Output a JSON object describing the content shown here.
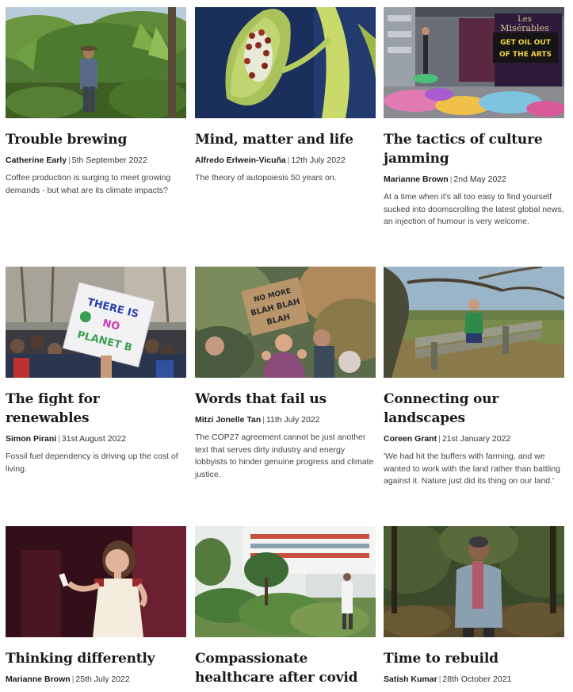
{
  "articles": [
    {
      "title": "Trouble brewing",
      "author": "Catherine Early",
      "separator": "|",
      "date": "5th September 2022",
      "excerpt": "Coffee production is surging to meet growing demands - but what are its climate impacts?",
      "image": "farmer-in-coffee-plantation-photo"
    },
    {
      "title": "Mind, matter and life",
      "author": "Alfredo Erlwein-Vicuña",
      "separator": "|",
      "date": "12th July 2022",
      "excerpt": "The theory of autopoiesis 50 years on.",
      "image": "ladybirds-on-green-leaf-photo"
    },
    {
      "title": "The tactics of culture jamming",
      "author": "Marianne Brown",
      "separator": "|",
      "date": "2nd May 2022",
      "excerpt": "At a time when it's all too easy to find yourself sucked into doomscrolling the latest global news, an injection of humour is very welcome.",
      "image": "protest-outside-theatre-photo",
      "image_text": [
        "GET OIL OUT",
        "OF THE ARTS"
      ]
    },
    {
      "title": "The fight for renewables",
      "author": "Simon Pirani",
      "separator": "|",
      "date": "31st August 2022",
      "excerpt": "Fossil fuel dependency is driving up the cost of living.",
      "image": "climate-march-placard-photo",
      "image_text": [
        "THERE IS",
        "NO",
        "PLANET B"
      ]
    },
    {
      "title": "Words that fail us",
      "author": "Mitzi Jonelle Tan",
      "separator": "|",
      "date": "11th July 2022",
      "excerpt": "The COP27 agreement cannot be just another text that serves dirty industry and energy lobbyists to hinder genuine progress and climate justice.",
      "image": "child-with-blah-placard-photo",
      "image_text": [
        "NO MORE",
        "BLAH BLAH",
        "BLAH"
      ]
    },
    {
      "title": "Connecting our landscapes",
      "author": "Coreen Grant",
      "separator": "|",
      "date": "21st January 2022",
      "excerpt": "'We had hit the buffers with farming, and we wanted to work with the land rather than battling against it. Nature just did its thing on our land.'",
      "image": "woman-on-fence-in-field-photo"
    },
    {
      "title": "Thinking differently",
      "author": "Marianne Brown",
      "separator": "|",
      "date": "25th July 2022",
      "excerpt": "",
      "image": "speaker-on-stage-photo"
    },
    {
      "title": "Compassionate healthcare after covid",
      "author": "",
      "separator": "",
      "date": "",
      "excerpt": "",
      "image": "hospital-garden-rendering-photo"
    },
    {
      "title": "Time to rebuild",
      "author": "Satish Kumar",
      "separator": "|",
      "date": "28th October 2021",
      "excerpt": "",
      "image": "man-in-woodland-photo"
    }
  ],
  "colors": {
    "title": "#1a1a1a",
    "body_text": "#444444",
    "separator": "#777777",
    "background": "#ffffff"
  }
}
